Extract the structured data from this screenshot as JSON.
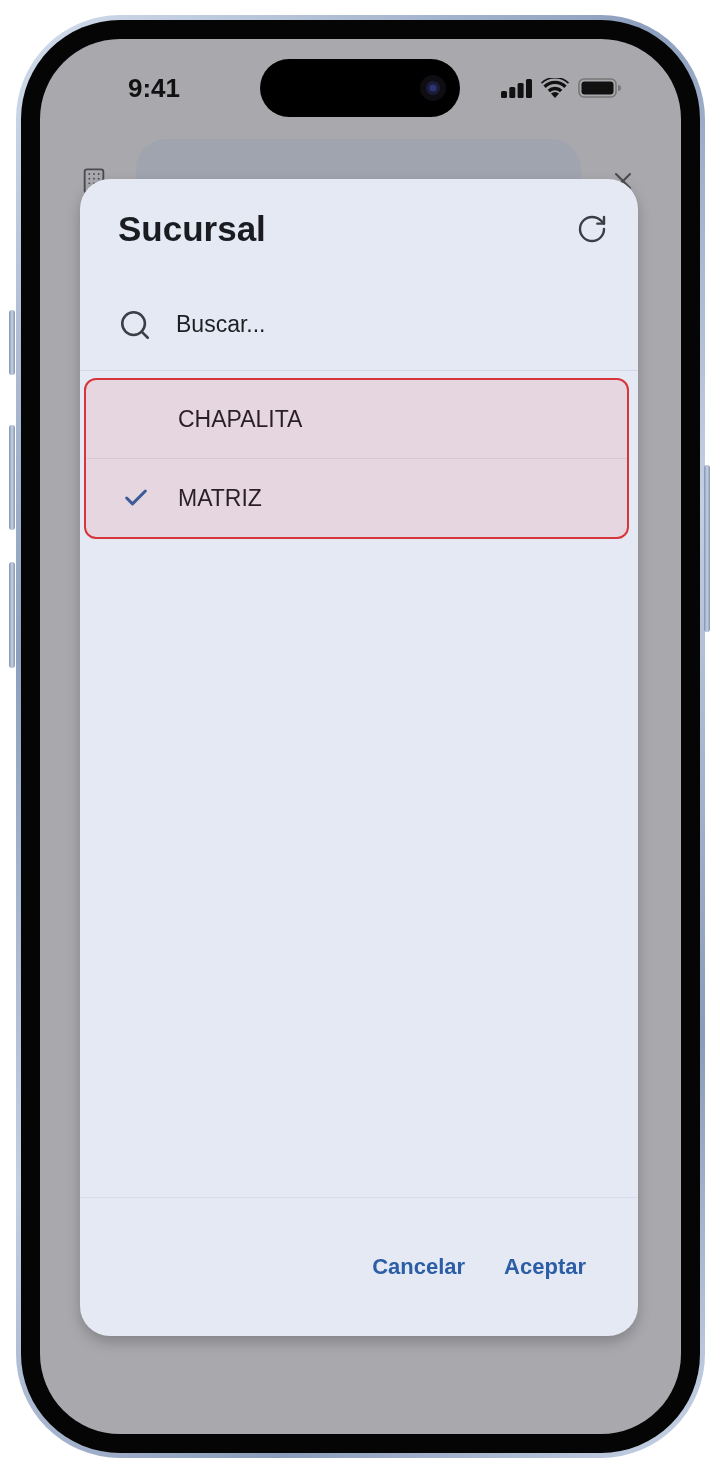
{
  "status_bar": {
    "time": "9:41"
  },
  "dialog": {
    "title": "Sucursal",
    "search": {
      "placeholder": "Buscar..."
    },
    "items": [
      {
        "label": "CHAPALITA",
        "selected": false
      },
      {
        "label": "MATRIZ",
        "selected": true
      }
    ],
    "buttons": [
      {
        "label": "Cancelar"
      },
      {
        "label": "Aceptar"
      }
    ]
  }
}
